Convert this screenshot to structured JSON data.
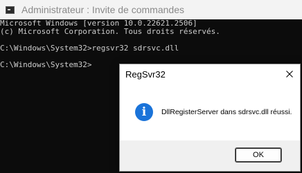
{
  "window": {
    "title": "Administrateur : Invite de commandes",
    "icon": "cmd-icon"
  },
  "console": {
    "lines": [
      "Microsoft Windows [version 10.0.22621.2506]",
      "(c) Microsoft Corporation. Tous droits réservés.",
      "",
      "C:\\Windows\\System32>regsvr32 sdrsvc.dll",
      "",
      "C:\\Windows\\System32>"
    ]
  },
  "dialog": {
    "title": "RegSvr32",
    "message": "DllRegisterServer dans sdrsvc.dll réussi.",
    "icon": "info-icon",
    "ok_label": "OK",
    "close_icon": "close-icon"
  },
  "colors": {
    "console_bg": "#0c0c0c",
    "console_text": "#cccccc",
    "info_blue": "#1a73d9",
    "titlebar_bg": "#f3f3f3"
  }
}
